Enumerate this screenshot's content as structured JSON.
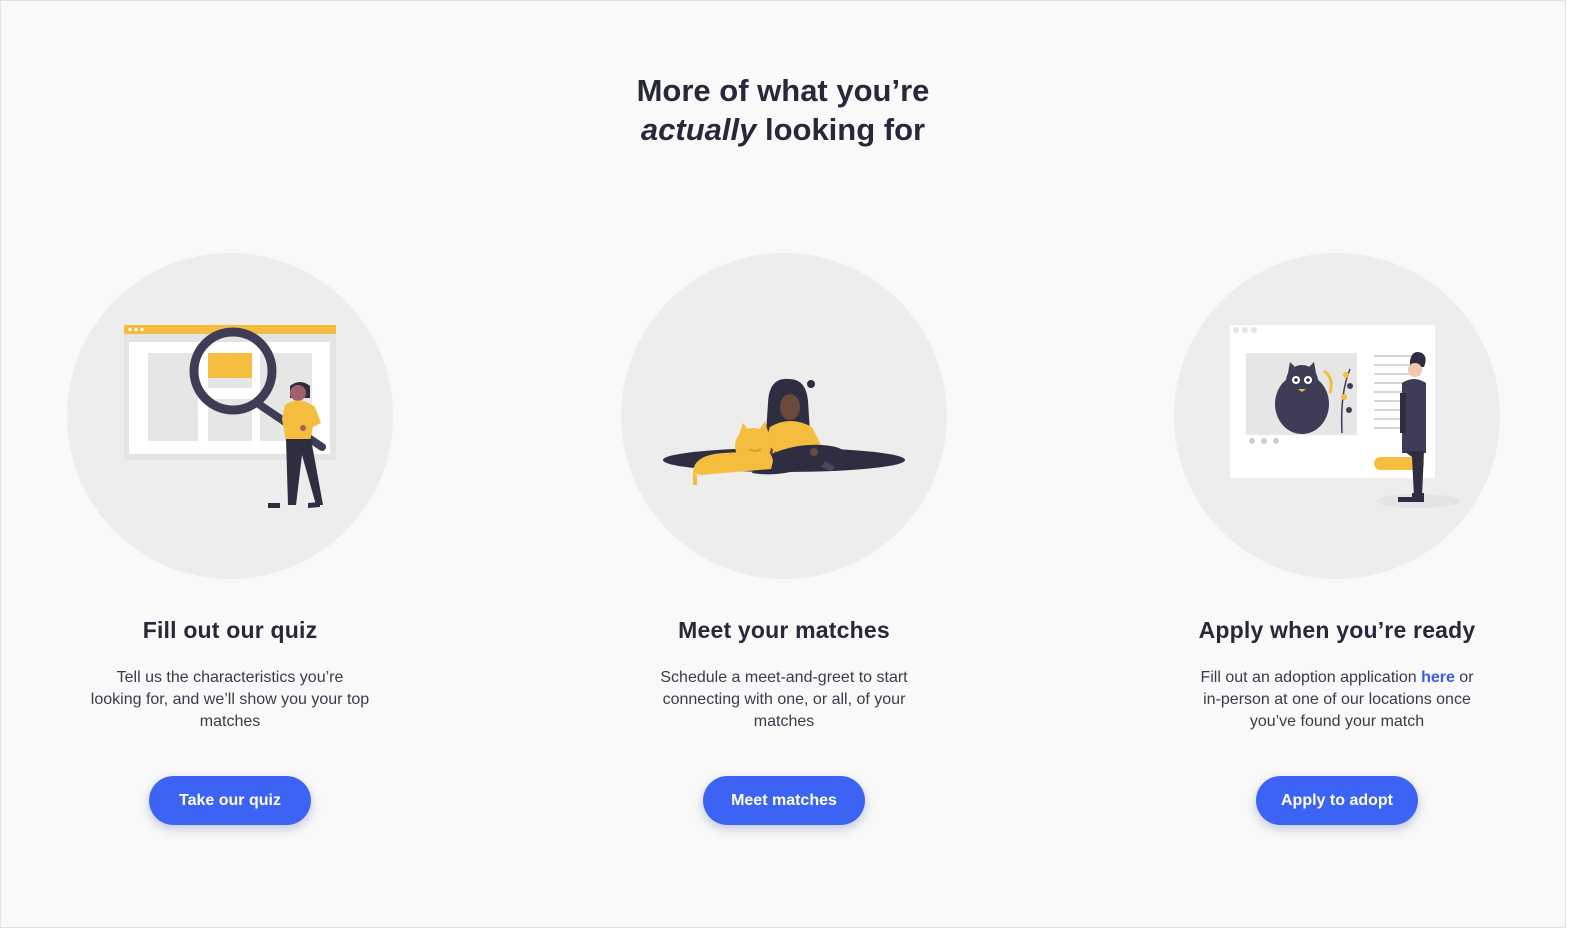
{
  "headline": {
    "line1": "More of what you’re",
    "line2_emphasis": "actually",
    "line2_rest": " looking for"
  },
  "steps": [
    {
      "title": "Fill out our quiz",
      "description": "Tell us the characteristics you’re looking for, and we’ll show you your top matches",
      "button": "Take our quiz",
      "illustration": "search-quiz-illustration"
    },
    {
      "title": "Meet your matches",
      "description": "Schedule a meet-and-greet to start connecting with one, or all, of your matches",
      "button": "Meet matches",
      "illustration": "person-with-cat-illustration"
    },
    {
      "title": "Apply when you’re ready",
      "description_before_link": "Fill out an adoption application ",
      "link": "here",
      "description_after_link": " or in-person at one of our locations once you’ve found your match",
      "button": "Apply to adopt",
      "illustration": "adoption-application-illustration"
    }
  ],
  "colors": {
    "accent": "#3d63f4",
    "link": "#3c5ae8",
    "illustration_yellow": "#f5bd3e",
    "illustration_dark": "#2f2e41",
    "text": "#27293a",
    "background": "#f9f9f9"
  }
}
